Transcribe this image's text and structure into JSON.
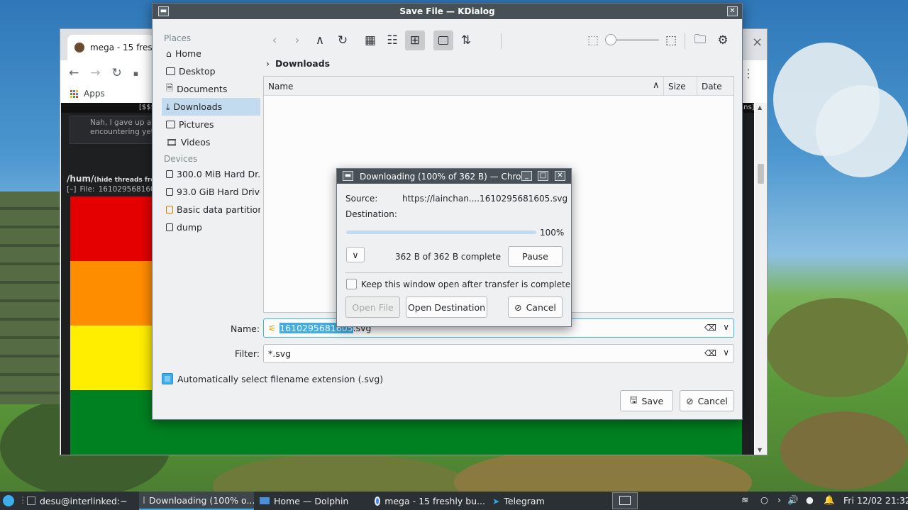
{
  "chrome": {
    "tab_title": "mega - 15 freshly",
    "close_tab": "×",
    "bookmarks": {
      "apps_label": "Apps"
    },
    "page": {
      "top_strip_left": "[$$$",
      "top_strip_right": "ans]",
      "post_text_line1": "Nah, I gave up ar",
      "post_text_line2": "encountering yet",
      "board_title": "/hum/",
      "board_note": "(hide threads from",
      "file_prefix": "[–]",
      "file_label": "File:",
      "file_name": "1610295681605"
    },
    "flag_colors": [
      "#e50000",
      "#ff8d00",
      "#ffee00",
      "#008121"
    ]
  },
  "kdialog": {
    "title": "Save File — KDialog",
    "places_header": "Places",
    "places": [
      {
        "label": "Home",
        "icon": "home-icon"
      },
      {
        "label": "Desktop",
        "icon": "desktop-icon"
      },
      {
        "label": "Documents",
        "icon": "documents-icon"
      },
      {
        "label": "Downloads",
        "icon": "downloads-icon",
        "selected": true
      },
      {
        "label": "Pictures",
        "icon": "pictures-icon"
      },
      {
        "label": "Videos",
        "icon": "videos-icon"
      }
    ],
    "devices_header": "Devices",
    "devices": [
      {
        "label": "300.0 MiB Hard Dr..."
      },
      {
        "label": "93.0 GiB Hard Drive"
      },
      {
        "label": "Basic data partition"
      },
      {
        "label": "dump"
      }
    ],
    "breadcrumb": "Downloads",
    "columns": {
      "name": "Name",
      "size": "Size",
      "date": "Date"
    },
    "name_label": "Name:",
    "name_value_selected": "1610295681605",
    "name_value_ext": ".svg",
    "filter_label": "Filter:",
    "filter_value": "*.svg",
    "auto_ext_label": "Automatically select filename extension (.svg)",
    "auto_ext_checked": true,
    "save_label": "Save",
    "cancel_label": "Cancel"
  },
  "download": {
    "title": "Downloading (100% of 362 B) — Chrom",
    "source_label": "Source:",
    "source_value": "https://lainchan....1610295681605.svg",
    "destination_label": "Destination:",
    "progress_percent": 100,
    "progress_text": "100%",
    "status_text": "362 B of 362 B complete",
    "pause_label": "Pause",
    "keep_open_label": "Keep this window open after transfer is complete",
    "keep_open_checked": false,
    "open_file_label": "Open File",
    "open_destination_label": "Open Destination",
    "cancel_label": "Cancel"
  },
  "taskbar": {
    "tasks": [
      {
        "label": "desu@interlinked:~"
      },
      {
        "label": "Downloading (100% o..."
      },
      {
        "label": "Home — Dolphin"
      },
      {
        "label": "mega - 15 freshly bu..."
      },
      {
        "label": "Telegram"
      }
    ],
    "clock": "Fri 12/02 21:32"
  }
}
